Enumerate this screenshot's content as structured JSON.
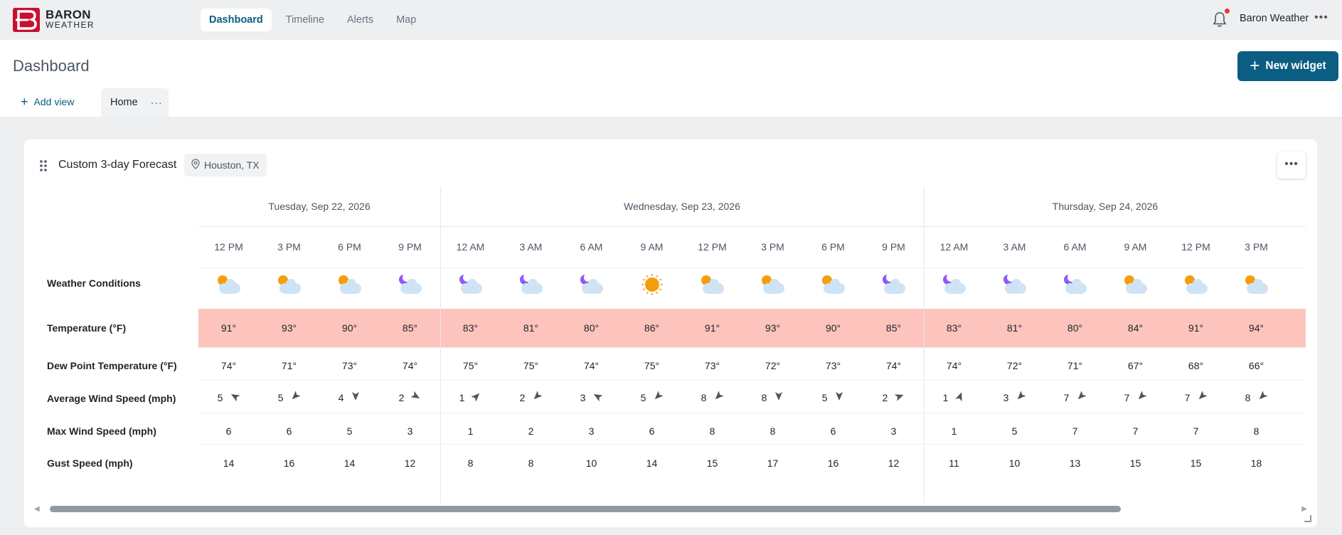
{
  "brand": {
    "line1": "BARON",
    "line2": "WEATHER",
    "color": "#c8102e"
  },
  "nav": {
    "items": [
      {
        "label": "Dashboard",
        "active": true
      },
      {
        "label": "Timeline",
        "active": false
      },
      {
        "label": "Alerts",
        "active": false
      },
      {
        "label": "Map",
        "active": false
      }
    ],
    "user_name": "Baron Weather",
    "more_glyph": "•••"
  },
  "header": {
    "page_title": "Dashboard",
    "new_widget_label": "New widget",
    "add_view_label": "Add view",
    "tab_label": "Home",
    "tab_more": "···"
  },
  "widget": {
    "title": "Custom 3-day Forecast",
    "location": "Houston, TX",
    "more_glyph": "•••"
  },
  "forecast": {
    "days": [
      {
        "label": "Tuesday, Sep 22, 2026",
        "span": 4
      },
      {
        "label": "Wednesday, Sep 23, 2026",
        "span": 8
      },
      {
        "label": "Thursday, Sep 24, 2026",
        "span": 6
      }
    ],
    "row_labels": {
      "conditions": "Weather Conditions",
      "temp": "Temperature (°F)",
      "dew": "Dew Point Temperature (°F)",
      "avg_wind": "Average Wind Speed (mph)",
      "max_wind": "Max Wind Speed (mph)",
      "gust": "Gust Speed (mph)"
    },
    "columns": [
      {
        "time": "12 PM",
        "icon": "sun-cloud-icon",
        "temp": "91°",
        "dew": "74°",
        "wind": "5",
        "wind_dir": 300,
        "max": "6",
        "gust": "14"
      },
      {
        "time": "3 PM",
        "icon": "sun-cloud-icon",
        "temp": "93°",
        "dew": "71°",
        "wind": "5",
        "wind_dir": 225,
        "max": "6",
        "gust": "16"
      },
      {
        "time": "6 PM",
        "icon": "sun-cloud-icon",
        "temp": "90°",
        "dew": "73°",
        "wind": "4",
        "wind_dir": 180,
        "max": "5",
        "gust": "14"
      },
      {
        "time": "9 PM",
        "icon": "moon-cloud-icon",
        "temp": "85°",
        "dew": "74°",
        "wind": "2",
        "wind_dir": 120,
        "max": "3",
        "gust": "12"
      },
      {
        "time": "12 AM",
        "icon": "moon-cloud-icon",
        "temp": "83°",
        "dew": "75°",
        "wind": "1",
        "wind_dir": 45,
        "max": "1",
        "gust": "8"
      },
      {
        "time": "3 AM",
        "icon": "moon-cloud-icon",
        "temp": "81°",
        "dew": "75°",
        "wind": "2",
        "wind_dir": 225,
        "max": "2",
        "gust": "8"
      },
      {
        "time": "6 AM",
        "icon": "moon-cloud-icon",
        "temp": "80°",
        "dew": "74°",
        "wind": "3",
        "wind_dir": 300,
        "max": "3",
        "gust": "10"
      },
      {
        "time": "9 AM",
        "icon": "sun-icon",
        "temp": "86°",
        "dew": "75°",
        "wind": "5",
        "wind_dir": 225,
        "max": "6",
        "gust": "14"
      },
      {
        "time": "12 PM",
        "icon": "sun-cloud-icon",
        "temp": "91°",
        "dew": "73°",
        "wind": "8",
        "wind_dir": 225,
        "max": "8",
        "gust": "15"
      },
      {
        "time": "3 PM",
        "icon": "sun-cloud-icon",
        "temp": "93°",
        "dew": "72°",
        "wind": "8",
        "wind_dir": 180,
        "max": "8",
        "gust": "17"
      },
      {
        "time": "6 PM",
        "icon": "sun-cloud-icon",
        "temp": "90°",
        "dew": "73°",
        "wind": "5",
        "wind_dir": 180,
        "max": "6",
        "gust": "16"
      },
      {
        "time": "9 PM",
        "icon": "moon-cloud-icon",
        "temp": "85°",
        "dew": "74°",
        "wind": "2",
        "wind_dir": 70,
        "max": "3",
        "gust": "12"
      },
      {
        "time": "12 AM",
        "icon": "moon-cloud-icon",
        "temp": "83°",
        "dew": "74°",
        "wind": "1",
        "wind_dir": 20,
        "max": "1",
        "gust": "11"
      },
      {
        "time": "3 AM",
        "icon": "moon-cloud-icon",
        "temp": "81°",
        "dew": "72°",
        "wind": "3",
        "wind_dir": 225,
        "max": "5",
        "gust": "10"
      },
      {
        "time": "6 AM",
        "icon": "moon-cloud-icon",
        "temp": "80°",
        "dew": "71°",
        "wind": "7",
        "wind_dir": 225,
        "max": "7",
        "gust": "13"
      },
      {
        "time": "9 AM",
        "icon": "sun-cloud-icon",
        "temp": "84°",
        "dew": "67°",
        "wind": "7",
        "wind_dir": 225,
        "max": "7",
        "gust": "15"
      },
      {
        "time": "12 PM",
        "icon": "sun-cloud-icon",
        "temp": "91°",
        "dew": "68°",
        "wind": "7",
        "wind_dir": 225,
        "max": "7",
        "gust": "15"
      },
      {
        "time": "3 PM",
        "icon": "sun-cloud-icon",
        "temp": "94°",
        "dew": "66°",
        "wind": "8",
        "wind_dir": 225,
        "max": "8",
        "gust": "18"
      }
    ]
  },
  "colors": {
    "accent": "#0b5d82",
    "temp_band": "#fdc4bd",
    "sun": "#f59e0b",
    "moon": "#8b5cf6",
    "cloud": "#cfe3f5"
  }
}
